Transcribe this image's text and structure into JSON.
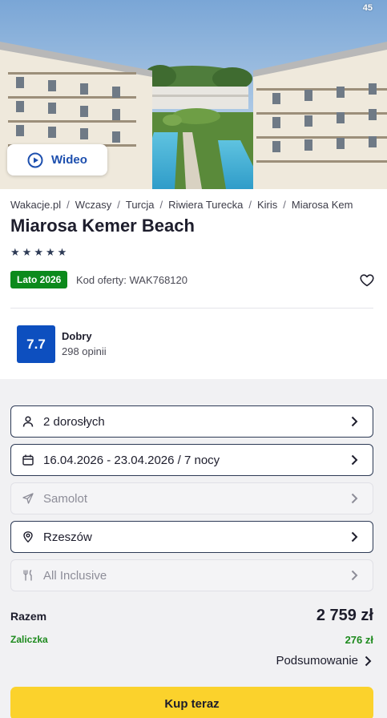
{
  "hero": {
    "photo_count": "45",
    "video_label": "Wideo"
  },
  "breadcrumb": [
    "Wakacje.pl",
    "Wczasy",
    "Turcja",
    "Riwiera Turecka",
    "Kiris",
    "Miarosa Kem"
  ],
  "hotel": {
    "name": "Miarosa Kemer Beach",
    "stars": 5,
    "season_badge": "Lato 2026",
    "offer_code": "Kod oferty: WAK768120"
  },
  "rating": {
    "score": "7.7",
    "label": "Dobry",
    "count": "298 opinii"
  },
  "options": [
    {
      "icon": "person-icon",
      "text": "2 dorosłych",
      "enabled": true
    },
    {
      "icon": "calendar-icon",
      "text": "16.04.2026 - 23.04.2026 / 7 nocy",
      "enabled": true
    },
    {
      "icon": "plane-icon",
      "text": "Samolot",
      "enabled": false
    },
    {
      "icon": "location-pin-icon",
      "text": "Rzeszów",
      "enabled": true
    },
    {
      "icon": "cutlery-icon",
      "text": "All Inclusive",
      "enabled": false
    }
  ],
  "totals": {
    "total_label": "Razem",
    "total_value": "2 759 zł",
    "deposit_label": "Zaliczka",
    "deposit_value": "276 zł",
    "summary_link": "Podsumowanie"
  },
  "buy_button": "Kup teraz",
  "colors": {
    "brand_blue": "#0d4fbf",
    "season_green": "#0c8a1c",
    "deposit_green": "#1d8a1d",
    "buy_yellow": "#fbd22c"
  }
}
